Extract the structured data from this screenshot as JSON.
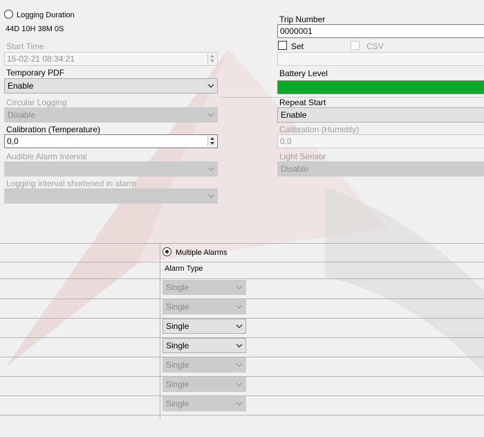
{
  "logging_duration": {
    "label": "Logging Duration",
    "value": "44D 10H 38M 0S",
    "selected": false
  },
  "start_time": {
    "label": "Start Time",
    "value": "15-02-21 08:34:21"
  },
  "temporary_pdf": {
    "label": "Temporary PDF",
    "value": "Enable"
  },
  "circular_logging": {
    "label": "Circular Logging",
    "value": "Disable"
  },
  "calibration_temperature": {
    "label": "Calibration (Temperature)",
    "value": "0,0"
  },
  "audible_alarm_interval": {
    "label": "Audible Alarm Interval",
    "value": ""
  },
  "logging_interval_shortened": {
    "label": "Logging interval shortened in alarm",
    "value": ""
  },
  "trip_number": {
    "label": "Trip Number",
    "value": "0000001"
  },
  "set_checkbox": {
    "label": "Set",
    "checked": false
  },
  "csv_checkbox": {
    "label": "CSV",
    "checked": false
  },
  "battery_level": {
    "label": "Battery Level",
    "fill_fraction": 1.0,
    "color": "#0aa82a"
  },
  "repeat_start": {
    "label": "Repeat Start",
    "value": "Enable"
  },
  "calibration_humidity": {
    "label": "Calibration (Humidity)",
    "value": "0,0"
  },
  "light_sensor": {
    "label": "Light Sensor",
    "value": "Disable"
  },
  "multiple_alarms": {
    "label": "Multiple Alarms",
    "selected": true,
    "column_header": "Alarm Type",
    "rows": [
      {
        "value": "Single",
        "enabled": false
      },
      {
        "value": "Single",
        "enabled": false
      },
      {
        "value": "Single",
        "enabled": true
      },
      {
        "value": "Single",
        "enabled": true
      },
      {
        "value": "Single",
        "enabled": false
      },
      {
        "value": "Single",
        "enabled": false
      },
      {
        "value": "Single",
        "enabled": false
      }
    ]
  }
}
